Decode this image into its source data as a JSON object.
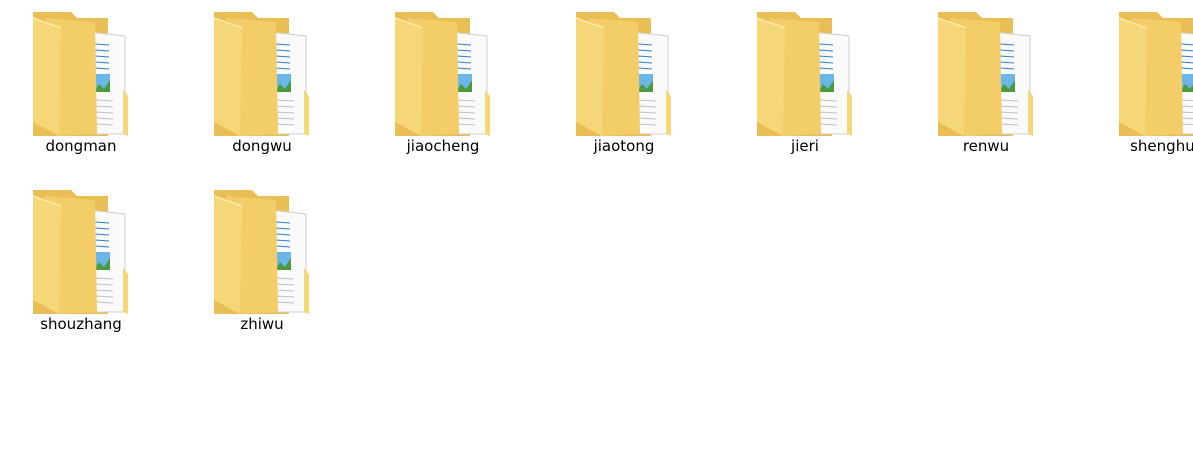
{
  "window": {
    "view": "large-icons"
  },
  "folders": [
    {
      "name": "dongman",
      "icon": "folder-icon"
    },
    {
      "name": "dongwu",
      "icon": "folder-icon"
    },
    {
      "name": "jiaocheng",
      "icon": "folder-icon"
    },
    {
      "name": "jiaotong",
      "icon": "folder-icon"
    },
    {
      "name": "jieri",
      "icon": "folder-icon"
    },
    {
      "name": "renwu",
      "icon": "folder-icon"
    },
    {
      "name": "shenghuo",
      "icon": "folder-icon"
    },
    {
      "name": "shouzhang",
      "icon": "folder-icon"
    },
    {
      "name": "zhiwu",
      "icon": "folder-icon"
    }
  ],
  "colors": {
    "folder_front": "#F6D777",
    "folder_back": "#E9BE55",
    "folder_mid": "#F2CD68",
    "paper": "#FAFAFA",
    "paper_lines": "#2F7FD0",
    "photo_sky": "#6BB6E8",
    "photo_ground": "#4C9A3E"
  }
}
